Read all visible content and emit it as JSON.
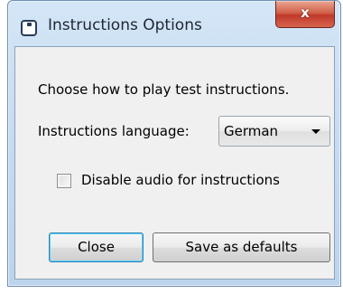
{
  "window": {
    "title": "Instructions Options",
    "close_glyph": "x"
  },
  "dialog": {
    "prompt": "Choose how to play test instructions.",
    "language_label": "Instructions language:",
    "language_value": "German",
    "disable_audio_label": "Disable audio for instructions",
    "disable_audio_checked": false
  },
  "buttons": {
    "close_label": "Close",
    "save_label": "Save as defaults"
  },
  "icons": {
    "app": "app-window-icon",
    "dropdown": "chevron-down-icon"
  }
}
